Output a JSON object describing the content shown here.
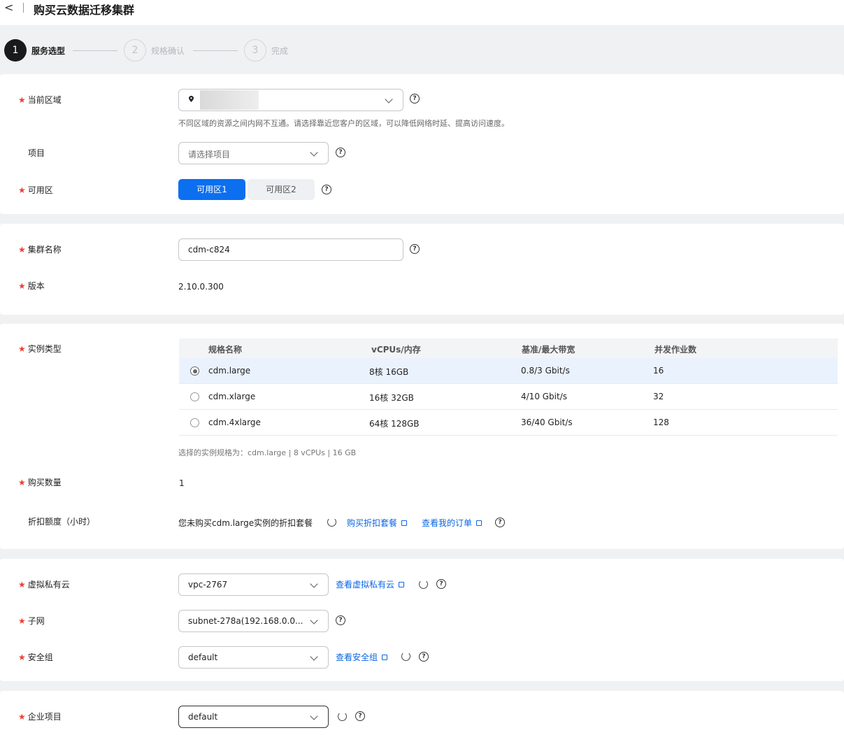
{
  "header": {
    "back_icon": "chevron-left-icon",
    "title": "购买云数据迁移集群"
  },
  "steps": [
    {
      "number": "1",
      "label": "服务选型",
      "state": "active"
    },
    {
      "number": "2",
      "label": "规格确认",
      "state": "todo"
    },
    {
      "number": "3",
      "label": "完成",
      "state": "todo"
    }
  ],
  "region": {
    "label": "当前区域",
    "required_mark": "★",
    "hint": "不同区域的资源之间内网不互通。请选择靠近您客户的区域，可以降低网络时延、提高访问速度。"
  },
  "project": {
    "label": "项目",
    "placeholder": "请选择项目"
  },
  "az": {
    "label": "可用区",
    "options": [
      "可用区1",
      "可用区2"
    ],
    "selected": "可用区1"
  },
  "cluster_name": {
    "label": "集群名称",
    "value": "cdm-c824"
  },
  "version": {
    "label": "版本",
    "value": "2.10.0.300"
  },
  "instance_type": {
    "label": "实例类型",
    "columns": [
      "规格名称",
      "vCPUs/内存",
      "基准/最大带宽",
      "并发作业数"
    ],
    "rows": [
      {
        "name": "cdm.large",
        "vcpu_mem": "8核 16GB",
        "bandwidth": "0.8/3 Gbit/s",
        "jobs": "16",
        "selected": true
      },
      {
        "name": "cdm.xlarge",
        "vcpu_mem": "16核 32GB",
        "bandwidth": "4/10 Gbit/s",
        "jobs": "32",
        "selected": false
      },
      {
        "name": "cdm.4xlarge",
        "vcpu_mem": "64核 128GB",
        "bandwidth": "36/40 Gbit/s",
        "jobs": "128",
        "selected": false
      }
    ],
    "summary": "选择的实例规格为：cdm.large | 8 vCPUs | 16 GB"
  },
  "quantity": {
    "label": "购买数量",
    "value": "1"
  },
  "discount": {
    "label": "折扣额度（小时）",
    "text": "您未购买cdm.large实例的折扣套餐",
    "buy_link": "购买折扣套餐",
    "orders_link": "查看我的订单"
  },
  "vpc": {
    "label": "虚拟私有云",
    "value": "vpc-2767",
    "link": "查看虚拟私有云"
  },
  "subnet": {
    "label": "子网",
    "value": "subnet-278a(192.168.0.0..."
  },
  "security_group": {
    "label": "安全组",
    "value": "default",
    "link": "查看安全组"
  },
  "enterprise_project": {
    "label": "企业项目",
    "value": "default"
  },
  "colors": {
    "primary": "#0b6ff0",
    "required": "#e8413a",
    "link": "#0a66e4"
  }
}
